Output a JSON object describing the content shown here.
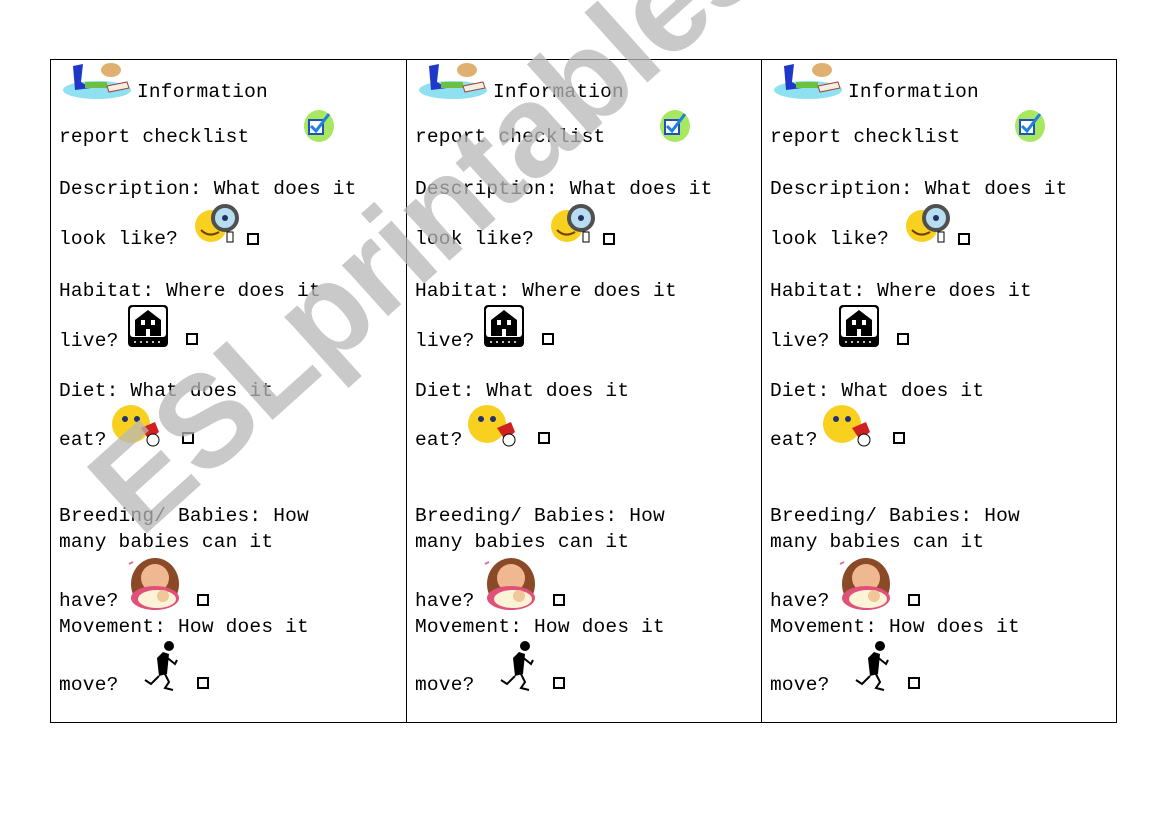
{
  "worksheet": {
    "watermark": "ESLprintables.com",
    "cards": [
      {
        "title_line1": "Information",
        "title_line2": "report checklist",
        "items": {
          "description_q": "Description: What does it",
          "description_q2": "look like?",
          "habitat_q": "Habitat: Where does it",
          "habitat_q2": "live?",
          "diet_q": "Diet: What does it",
          "diet_q2": "eat?",
          "breeding_q": "Breeding/ Babies: How",
          "breeding_q2": "many babies can it",
          "breeding_q3": "have?",
          "movement_q": "Movement: How does it",
          "movement_q2": "move?"
        }
      },
      {
        "title_line1": "Information",
        "title_line2": "report checklist",
        "items": {
          "description_q": "Description: What does it",
          "description_q2": "look like?",
          "habitat_q": "Habitat: Where does it",
          "habitat_q2": "live?",
          "diet_q": "Diet: What does it",
          "diet_q2": "eat?",
          "breeding_q": "Breeding/ Babies: How",
          "breeding_q2": "many babies can it",
          "breeding_q3": "have?",
          "movement_q": "Movement: How does it",
          "movement_q2": "move?"
        }
      },
      {
        "title_line1": "Information",
        "title_line2": "report checklist",
        "items": {
          "description_q": "Description: What does it",
          "description_q2": "look like?",
          "habitat_q": "Habitat: Where does it",
          "habitat_q2": "live?",
          "diet_q": "Diet: What does it",
          "diet_q2": "eat?",
          "breeding_q": "Breeding/ Babies: How",
          "breeding_q2": "many babies can it",
          "breeding_q3": "have?",
          "movement_q": "Movement: How does it",
          "movement_q2": "move?"
        }
      }
    ]
  }
}
